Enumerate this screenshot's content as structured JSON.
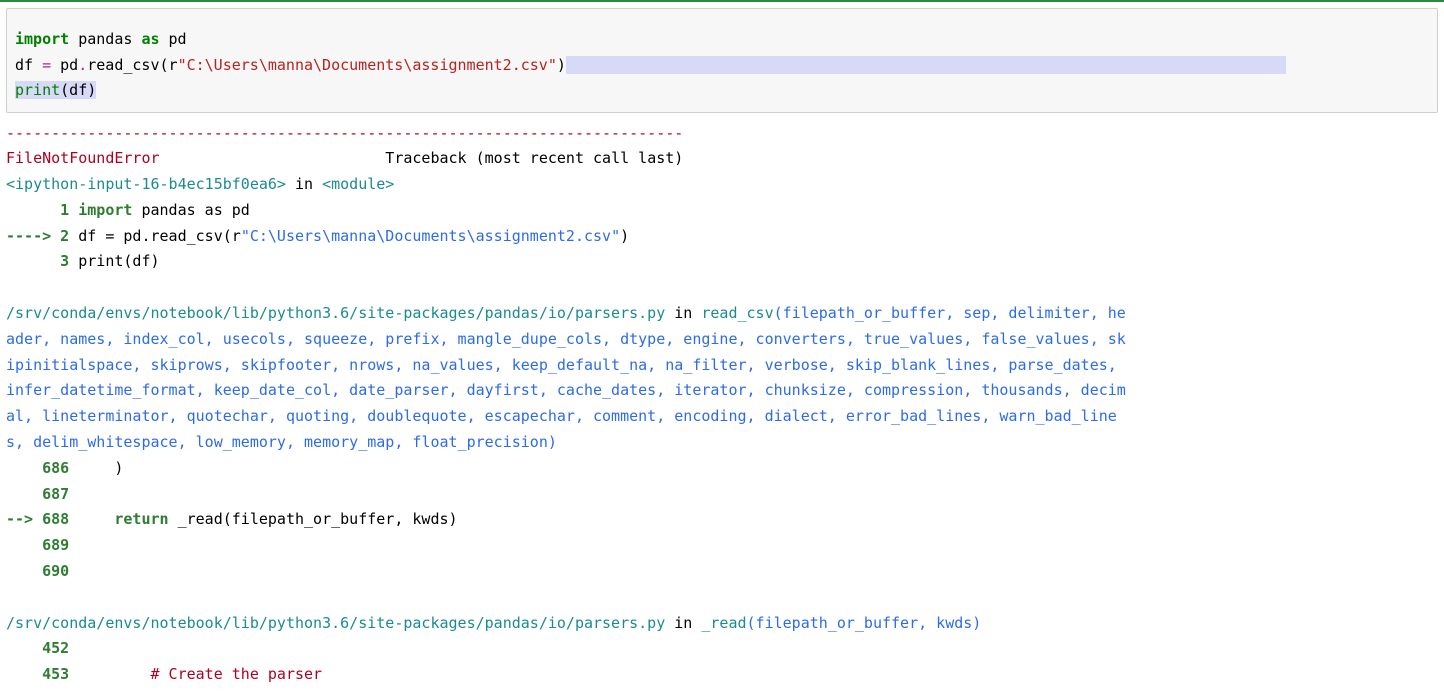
{
  "code": {
    "kw_import": "import",
    "pandas": " pandas ",
    "kw_as": "as",
    "pd": " pd",
    "df_eq": "df ",
    "op_eq": "=",
    "pd_read": " pd",
    "dot": ".",
    "read_csv": "read_csv(r",
    "str_path": "\"C:\\Users\\manna\\Documents\\assignment2.csv\"",
    "close_paren": ")",
    "print": "print",
    "print_args": "(df)"
  },
  "trace": {
    "dashes": "---------------------------------------------------------------------------",
    "error_name": "FileNotFoundError",
    "trace_label": "                         Traceback (most recent call last)",
    "ipy_module_pre": "<ipython-input-16-b4ec15bf0ea6>",
    "in_word": " in ",
    "module_tag": "<module>",
    "l1_num": "      1 ",
    "l1_imp": "import",
    "l1_rest": " pandas as pd",
    "arrow2": "----> 2 ",
    "l2_pre": "df ",
    "l2_eq": "=",
    "l2_mid": " pd",
    "l2_dot": ".",
    "l2_read": "read_csv",
    "l2_paren": "(r",
    "l2_str": "\"C:\\Users\\manna\\Documents\\assignment2.csv\"",
    "l2_close": ")",
    "l3_num": "      3 ",
    "l3_rest": "print(df)",
    "path1": "/srv/conda/envs/notebook/lib/python3.6/site-packages/pandas/io/parsers.py",
    "in1": " in ",
    "func1": "read_csv",
    "sig1a": "(filepath_or_buffer, sep, delimiter, he",
    "sig1b": "ader, names, index_col, usecols, squeeze, prefix, mangle_dupe_cols, dtype, engine, converters, true_values, false_values, sk",
    "sig1c": "ipinitialspace, skiprows, skipfooter, nrows, na_values, keep_default_na, na_filter, verbose, skip_blank_lines, parse_dates, ",
    "sig1d": "infer_datetime_format, keep_date_col, date_parser, dayfirst, cache_dates, iterator, chunksize, compression, thousands, decim",
    "sig1e": "al, lineterminator, quotechar, quoting, doublequote, escapechar, comment, encoding, dialect, error_bad_lines, warn_bad_line",
    "sig1f": "s, delim_whitespace, low_memory, memory_map, float_precision)",
    "n686": "    686",
    "c686": "     )",
    "n687": "    687",
    "arrow688": "--> ",
    "n688": "688",
    "c688_ret": "     return",
    "c688_rest": " _read(filepath_or_buffer, kwds)",
    "n689": "    689",
    "n690": "    690",
    "path2": "/srv/conda/envs/notebook/lib/python3.6/site-packages/pandas/io/parsers.py",
    "in2": " in ",
    "func2": "_read",
    "sig2": "(filepath_or_buffer, kwds)",
    "n452": "    452",
    "n453p": "    453",
    "c453": "         # Create the parser"
  }
}
